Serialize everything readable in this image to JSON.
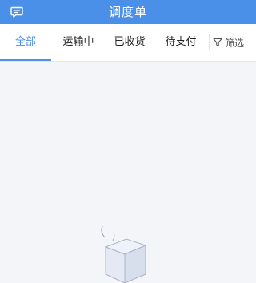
{
  "header": {
    "title": "调度单",
    "message_icon": "chat-bubble-icon"
  },
  "tabs": [
    {
      "label": "全部",
      "active": true
    },
    {
      "label": "运输中",
      "active": false
    },
    {
      "label": "已收货",
      "active": false
    },
    {
      "label": "待支付",
      "active": false
    }
  ],
  "filter": {
    "label": "筛选",
    "icon": "filter-funnel-icon"
  },
  "colors": {
    "accent": "#4a8fe8",
    "background": "#f3f5f9"
  }
}
